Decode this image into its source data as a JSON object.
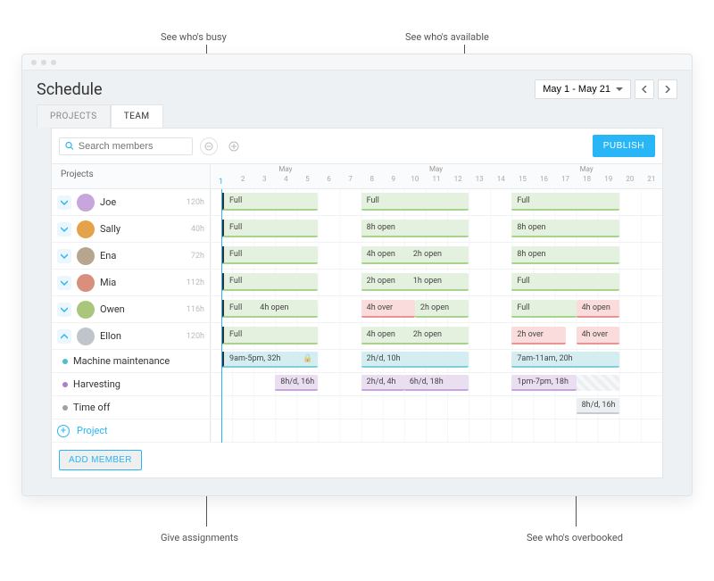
{
  "annotations": {
    "busy": "See who's busy",
    "available": "See who's available",
    "assign": "Give assignments",
    "overbooked": "See who's overbooked"
  },
  "pageTitle": "Schedule",
  "dateRange": "May 1 - May 21",
  "tabs": {
    "projects": "PROJECTS",
    "team": "TEAM"
  },
  "search": {
    "placeholder": "Search members"
  },
  "publish": "PUBLISH",
  "projectsHeader": "Projects",
  "monthLabel": "May",
  "days": [
    "1",
    "2",
    "3",
    "4",
    "5",
    "6",
    "7",
    "8",
    "9",
    "10",
    "11",
    "12",
    "13",
    "14",
    "15",
    "16",
    "17",
    "18",
    "19",
    "20",
    "21"
  ],
  "people": [
    {
      "name": "Joe",
      "hours": "120h",
      "color": "#c7a6dd"
    },
    {
      "name": "Sally",
      "hours": "40h",
      "color": "#e4a24a"
    },
    {
      "name": "Ena",
      "hours": "72h",
      "color": "#b6a58f"
    },
    {
      "name": "Mia",
      "hours": "112h",
      "color": "#d98f7c"
    },
    {
      "name": "Owen",
      "hours": "116h",
      "color": "#a9c77b"
    },
    {
      "name": "Ellon",
      "hours": "120h",
      "color": "#bfc5cb"
    }
  ],
  "bars": {
    "joe": [
      {
        "t": "Full"
      },
      {
        "t": "Full"
      },
      {
        "t": "Full"
      }
    ],
    "sally": [
      {
        "t": "Full"
      },
      {
        "t": "8h open"
      },
      {
        "t": "8h open"
      }
    ],
    "ena": [
      {
        "a": "Full"
      },
      {
        "a": "4h open",
        "b": "2h open"
      },
      {
        "a": "8h open"
      }
    ],
    "mia": [
      {
        "a": "Full"
      },
      {
        "a": "2h open",
        "b": "1h open"
      },
      {
        "a": "Full"
      }
    ],
    "owen": [
      {
        "a": "Full",
        "b": "4h open"
      },
      {
        "a": "4h over",
        "b": "2h open"
      },
      {
        "a": "Full",
        "b": "4h open"
      }
    ],
    "ellon": [
      {
        "a": "Full"
      },
      {
        "a": "4h open",
        "b": "2h open"
      },
      {
        "a": "2h over",
        "b": "4h over"
      }
    ]
  },
  "tasks": {
    "maint": {
      "name": "Machine maintenance",
      "b1": "9am-5pm, 32h",
      "b2": "2h/d, 10h",
      "b3": "7am-11am, 20h"
    },
    "harv": {
      "name": "Harvesting",
      "b1": "8h/d, 16h",
      "b2": "2h/d, 4h",
      "b3": "6h/d, 18h",
      "b4": "1pm-7pm, 18h"
    },
    "off": {
      "name": "Time off",
      "b1": "8h/d, 16h"
    }
  },
  "addProject": "Project",
  "addMember": "ADD MEMBER",
  "lockGlyph": "🔒"
}
